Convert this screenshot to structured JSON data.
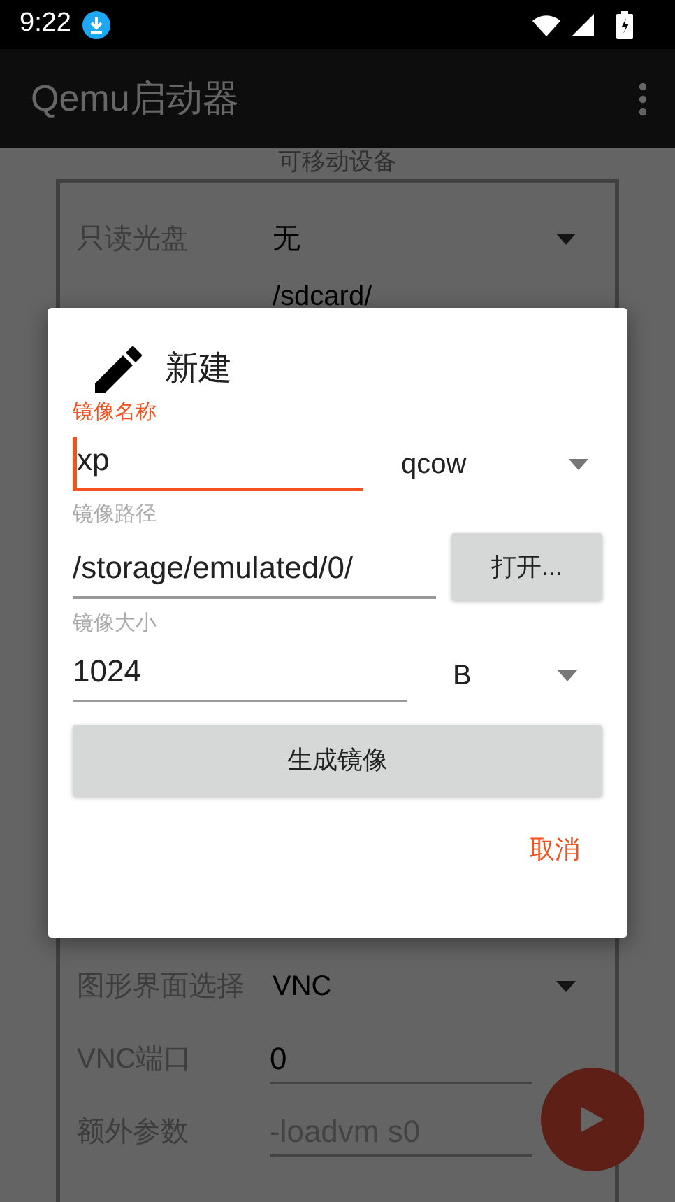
{
  "status_bar": {
    "time": "9:22"
  },
  "app_bar": {
    "title": "Qemu启动器"
  },
  "background_form": {
    "section_title": "可移动设备",
    "rows_top": [
      {
        "kind": "dropdown",
        "label": "只读光盘",
        "value": "无"
      },
      {
        "kind": "dropdown",
        "value": "/sdcard/"
      }
    ],
    "rows_bottom": [
      {
        "kind": "dropdown",
        "label": "图形界面选择",
        "value": "VNC"
      },
      {
        "kind": "input",
        "label": "VNC端口",
        "value": "0"
      },
      {
        "kind": "input",
        "label": "额外参数",
        "placeholder": "-loadvm s0"
      }
    ]
  },
  "dialog": {
    "title": "新建",
    "name_field": {
      "label": "镜像名称",
      "value": "xp",
      "focused": true
    },
    "format_dropdown": {
      "value": "qcow"
    },
    "path_field": {
      "label": "镜像路径",
      "value": "/storage/emulated/0/",
      "focused": false
    },
    "open_button": "打开...",
    "size_field": {
      "label": "镜像大小",
      "value": "1024",
      "focused": false
    },
    "unit_dropdown": {
      "value": "B"
    },
    "create_button": "生成镜像",
    "cancel_button": "取消"
  }
}
